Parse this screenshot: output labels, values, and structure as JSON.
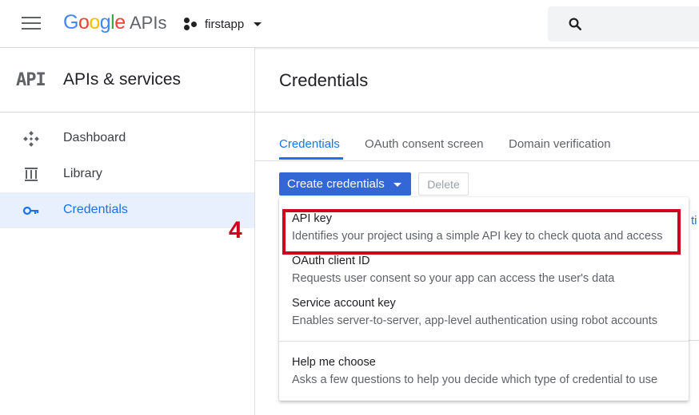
{
  "header": {
    "logo_letters": [
      "G",
      "o",
      "o",
      "g",
      "l",
      "e"
    ],
    "logo_suffix": "APIs",
    "project_name": "firstapp"
  },
  "sidebar": {
    "glyph": "API",
    "title": "APIs & services",
    "items": [
      {
        "label": "Dashboard",
        "icon": "dashboard-icon",
        "active": false
      },
      {
        "label": "Library",
        "icon": "library-icon",
        "active": false
      },
      {
        "label": "Credentials",
        "icon": "key-icon",
        "active": true
      }
    ]
  },
  "annotation": "4",
  "main": {
    "title": "Credentials",
    "tabs": [
      {
        "label": "Credentials",
        "active": true
      },
      {
        "label": "OAuth consent screen",
        "active": false
      },
      {
        "label": "Domain verification",
        "active": false
      }
    ],
    "create_button": "Create credentials",
    "delete_button": "Delete",
    "peek_text": "ti"
  },
  "menu": {
    "items": [
      {
        "title": "API key",
        "description": "Identifies your project using a simple API key to check quota and access"
      },
      {
        "title": "OAuth client ID",
        "description": "Requests user consent so your app can access the user's data"
      },
      {
        "title": "Service account key",
        "description": "Enables server-to-server, app-level authentication using robot accounts"
      },
      {
        "title": "Help me choose",
        "description": "Asks a few questions to help you decide which type of credential to use"
      }
    ]
  },
  "colors": {
    "accent": "#1a73e8",
    "button": "#3367d6",
    "highlight": "#d0021b"
  }
}
